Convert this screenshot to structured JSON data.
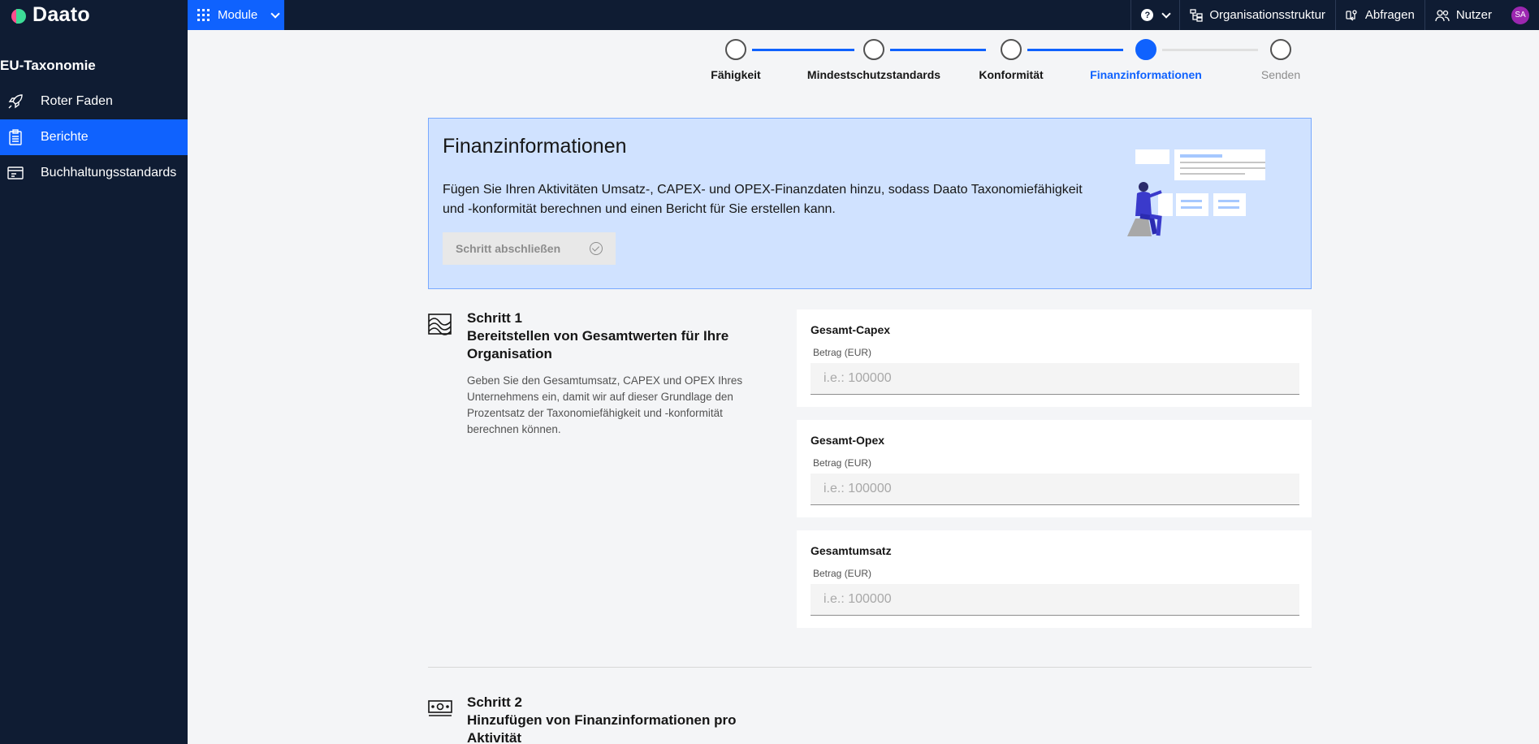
{
  "app": {
    "logo_text": "Daato"
  },
  "topbar": {
    "module_label": "Module",
    "help_glyph": "?",
    "org_label": "Organisationsstruktur",
    "queries_label": "Abfragen",
    "users_label": "Nutzer",
    "avatar_initials": "SA"
  },
  "sidebar": {
    "title": "EU-Taxonomie",
    "items": [
      {
        "label": "Roter Faden",
        "icon": "rocket-icon"
      },
      {
        "label": "Berichte",
        "icon": "clipboard-icon",
        "active": true
      },
      {
        "label": "Buchhaltungsstandards",
        "icon": "ledger-icon"
      }
    ]
  },
  "stepper": {
    "steps": [
      {
        "label": "Fähigkeit",
        "state": "done"
      },
      {
        "label": "Mindestschutzstandards",
        "state": "done"
      },
      {
        "label": "Konformität",
        "state": "done"
      },
      {
        "label": "Finanzinformationen",
        "state": "current"
      },
      {
        "label": "Senden",
        "state": "future"
      }
    ]
  },
  "banner": {
    "title": "Finanzinformationen",
    "text": "Fügen Sie Ihren Aktivitäten Umsatz-, CAPEX- und OPEX-Finanzdaten hinzu, sodass Daato Taxonomiefähigkeit und -konformität berechnen und einen Bericht für Sie erstellen kann.",
    "button_label": "Schritt abschließen"
  },
  "step1": {
    "number": "Schritt 1",
    "heading": "Bereitstellen von Gesamtwerten für Ihre Organisation",
    "description": "Geben Sie den Gesamtumsatz, CAPEX und OPEX Ihres Unternehmens ein, damit wir auf dieser Grundlage den Prozentsatz der Taxonomiefähigkeit und -konformität berechnen können.",
    "fields": [
      {
        "title": "Gesamt-Capex",
        "label": "Betrag (EUR)",
        "placeholder": "i.e.: 100000",
        "value": ""
      },
      {
        "title": "Gesamt-Opex",
        "label": "Betrag (EUR)",
        "placeholder": "i.e.: 100000",
        "value": ""
      },
      {
        "title": "Gesamtumsatz",
        "label": "Betrag (EUR)",
        "placeholder": "i.e.: 100000",
        "value": ""
      }
    ]
  },
  "step2": {
    "number": "Schritt 2",
    "heading": "Hinzufügen von Finanzinformationen pro Aktivität"
  },
  "colors": {
    "nav_bg": "#0f1c33",
    "accent": "#0f62fe",
    "banner_bg": "#d0e2ff",
    "avatar_bg": "#9c27b0"
  }
}
